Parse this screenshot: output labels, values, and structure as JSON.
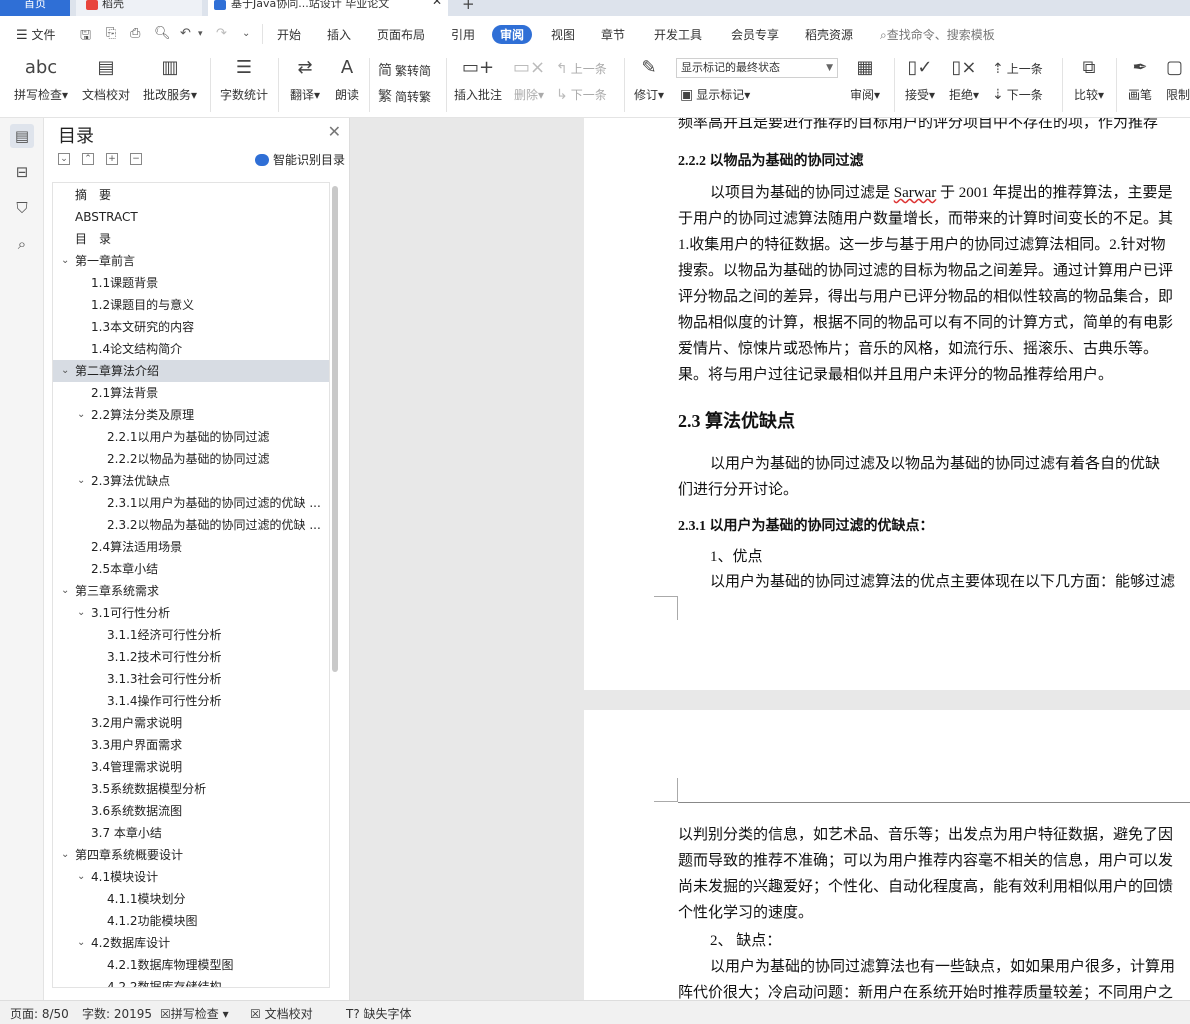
{
  "tabs": {
    "home": "首页",
    "docer": "稻壳",
    "active": "基于Java协同...站设计 毕业论文"
  },
  "menu": {
    "file": "文件",
    "items": [
      "开始",
      "插入",
      "页面布局",
      "引用",
      "审阅",
      "视图",
      "章节",
      "开发工具",
      "会员专享",
      "稻壳资源"
    ],
    "active_index": 4,
    "search": "查找命令、搜索模板"
  },
  "ribbon": {
    "spell": "拼写检查",
    "doc_check": "文档校对",
    "annot_service": "批改服务",
    "word_count": "字数统计",
    "translate": "翻译",
    "read_aloud": "朗读",
    "trad_to_simp": "繁转简",
    "simp_to_trad": "简转繁",
    "insert_comment": "插入批注",
    "delete": "删除",
    "prev_comment": "上一条",
    "next_comment": "下一条",
    "track": "修订",
    "markup_select": "显示标记的最终状态",
    "show_markup": "显示标记",
    "review": "审阅",
    "accept": "接受",
    "reject": "拒绝",
    "prev_change": "上一条",
    "next_change": "下一条",
    "compare": "比较",
    "ink": "画笔",
    "restrict": "限制"
  },
  "toc": {
    "title": "目录",
    "smart": "智能识别目录",
    "items": [
      {
        "text": "摘　要",
        "level": 0,
        "caret": ""
      },
      {
        "text": "ABSTRACT",
        "level": 0,
        "caret": ""
      },
      {
        "text": "目　录",
        "level": 0,
        "caret": ""
      },
      {
        "text": "第一章前言",
        "level": 0,
        "caret": "v"
      },
      {
        "text": "1.1课题背景",
        "level": 1,
        "caret": ""
      },
      {
        "text": "1.2课题目的与意义",
        "level": 1,
        "caret": ""
      },
      {
        "text": "1.3本文研究的内容",
        "level": 1,
        "caret": ""
      },
      {
        "text": "1.4论文结构简介",
        "level": 1,
        "caret": ""
      },
      {
        "text": "第二章算法介绍",
        "level": 0,
        "caret": "v",
        "selected": true
      },
      {
        "text": "2.1算法背景",
        "level": 1,
        "caret": ""
      },
      {
        "text": "2.2算法分类及原理",
        "level": 1,
        "caret": "v"
      },
      {
        "text": "2.2.1以用户为基础的协同过滤",
        "level": 2,
        "caret": ""
      },
      {
        "text": "2.2.2以物品为基础的协同过滤",
        "level": 2,
        "caret": ""
      },
      {
        "text": "2.3算法优缺点",
        "level": 1,
        "caret": "v"
      },
      {
        "text": "2.3.1以用户为基础的协同过滤的优缺 ...",
        "level": 2,
        "caret": ""
      },
      {
        "text": "2.3.2以物品为基础的协同过滤的优缺 ...",
        "level": 2,
        "caret": ""
      },
      {
        "text": "2.4算法适用场景",
        "level": 1,
        "caret": ""
      },
      {
        "text": "2.5本章小结",
        "level": 1,
        "caret": ""
      },
      {
        "text": "第三章系统需求",
        "level": 0,
        "caret": "v"
      },
      {
        "text": "3.1可行性分析",
        "level": 1,
        "caret": "v"
      },
      {
        "text": "3.1.1经济可行性分析",
        "level": 2,
        "caret": ""
      },
      {
        "text": "3.1.2技术可行性分析",
        "level": 2,
        "caret": ""
      },
      {
        "text": "3.1.3社会可行性分析",
        "level": 2,
        "caret": ""
      },
      {
        "text": "3.1.4操作可行性分析",
        "level": 2,
        "caret": ""
      },
      {
        "text": "3.2用户需求说明",
        "level": 1,
        "caret": ""
      },
      {
        "text": "3.3用户界面需求",
        "level": 1,
        "caret": ""
      },
      {
        "text": "3.4管理需求说明",
        "level": 1,
        "caret": ""
      },
      {
        "text": "3.5系统数据模型分析",
        "level": 1,
        "caret": ""
      },
      {
        "text": "3.6系统数据流图",
        "level": 1,
        "caret": ""
      },
      {
        "text": "3.7  本章小结",
        "level": 1,
        "caret": ""
      },
      {
        "text": "第四章系统概要设计",
        "level": 0,
        "caret": "v"
      },
      {
        "text": "4.1模块设计",
        "level": 1,
        "caret": "v"
      },
      {
        "text": "4.1.1模块划分",
        "level": 2,
        "caret": ""
      },
      {
        "text": "4.1.2功能模块图",
        "level": 2,
        "caret": ""
      },
      {
        "text": "4.2数据库设计",
        "level": 1,
        "caret": "v"
      },
      {
        "text": "4.2.1数据库物理模型图",
        "level": 2,
        "caret": ""
      },
      {
        "text": "4.2.2数据库存储结构",
        "level": 2,
        "caret": ""
      }
    ]
  },
  "doc": {
    "p1": {
      "l0": "频率高并且是要进行推荐的目标用户的评分项目中不存在的项，作为推荐",
      "h222": "2.2.2  以物品为基础的协同过滤",
      "l1a": "以项目为基础的协同过滤是 ",
      "l1u": "Sarwar",
      "l1b": " 于 2001 年提出的推荐算法，主要是",
      "l2": "于用户的协同过滤算法随用户数量增长，而带来的计算时间变长的不足。其",
      "l3": "1.收集用户的特征数据。这一步与基于用户的协同过滤算法相同。2.针对物",
      "l4": "搜索。以物品为基础的协同过滤的目标为物品之间差异。通过计算用户已评",
      "l5": "评分物品之间的差异，得出与用户已评分物品的相似性较高的物品集合，即",
      "l6": "物品相似度的计算，根据不同的物品可以有不同的计算方式，简单的有电影",
      "l7": "爱情片、惊悚片或恐怖片；音乐的风格，如流行乐、摇滚乐、古典乐等。",
      "l8": "果。将与用户过往记录最相似并且用户未评分的物品推荐给用户。",
      "h23": "2.3  算法优缺点",
      "l9": "以用户为基础的协同过滤及以物品为基础的协同过滤有着各自的优缺",
      "l10": "们进行分开讨论。",
      "h231": "2.3.1  以用户为基础的协同过滤的优缺点：",
      "l11": "1、优点",
      "l12": "以用户为基础的协同过滤算法的优点主要体现在以下几方面：能够过滤"
    },
    "p2": {
      "l1": "以判别分类的信息，如艺术品、音乐等；出发点为用户特征数据，避免了因",
      "l2": "题而导致的推荐不准确；可以为用户推荐内容毫不相关的信息，用户可以发",
      "l3": "尚未发掘的兴趣爱好；个性化、自动化程度高，能有效利用相似用户的回馈",
      "l4": "个性化学习的速度。",
      "l5": "2、  缺点：",
      "l6": "以用户为基础的协同过滤算法也有一些缺点，如如果用户很多，计算用",
      "l7": "阵代价很大；冷启动问题：新用户在系统开始时推荐质量较差；不同用户之"
    }
  },
  "status": {
    "page": "页面: 8/50",
    "words": "字数: 20195",
    "spell": "拼写检查",
    "doc_check": "文档校对",
    "missing_font": "缺失字体"
  }
}
